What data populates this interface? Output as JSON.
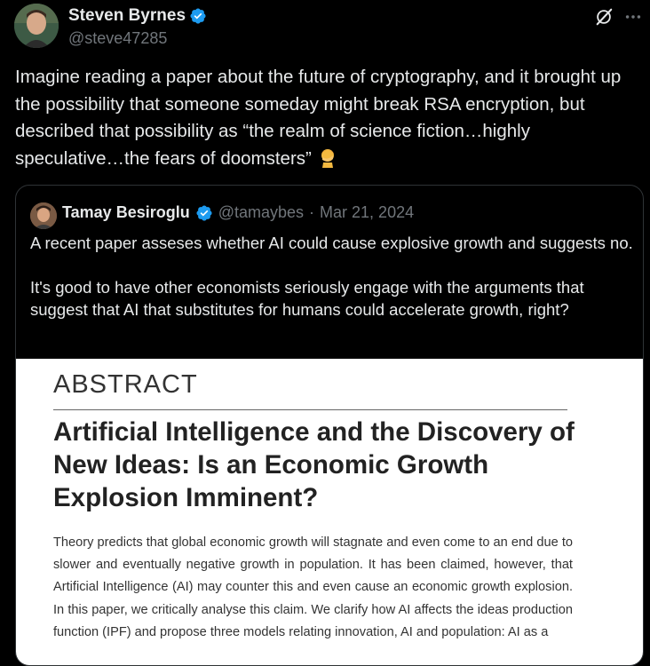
{
  "author": {
    "name": "Steven Byrnes",
    "handle": "@steve47285",
    "avatar_icon": "avatar-photo",
    "verified_icon": "verified-badge-icon"
  },
  "header_icons": [
    "grok-icon",
    "more-options-icon"
  ],
  "tweet": {
    "text": "Imagine reading a paper about the future of cryptography, and it brought up the possibility that someone someday might break RSA encryption, but described that possibility as “the realm of science fiction…highly speculative…the fears of doomsters”",
    "emoji_icon": "facepalm-emoji-icon"
  },
  "quote": {
    "author_name": "Tamay Besiroglu",
    "handle": "@tamaybes",
    "separator": "·",
    "date": "Mar 21, 2024",
    "paragraphs": [
      "A recent paper asseses whether AI could cause explosive growth and suggests no.",
      "It's good to have other economists seriously engage with the arguments that suggest that AI that substitutes for humans could accelerate growth, right?"
    ],
    "image": {
      "heading": "ABSTRACT",
      "title": "Artificial Intelligence and the Discovery of New Ideas: Is an Economic Growth Explosion Imminent?",
      "body": "Theory predicts that global economic growth will stagnate and even come to an end due to slower and eventually negative growth in population. It has been claimed, however, that Artificial Intelligence (AI) may counter this and even cause an economic growth explosion. In this paper, we critically analyse this claim. We clarify how AI affects the ideas production function (IPF) and propose three models relating innovation, AI and population: AI as a"
    }
  },
  "colors": {
    "background": "#000000",
    "text_primary": "#e7e9ea",
    "text_secondary": "#71767b",
    "verified_blue": "#1d9bf0",
    "border": "#2f3336"
  }
}
